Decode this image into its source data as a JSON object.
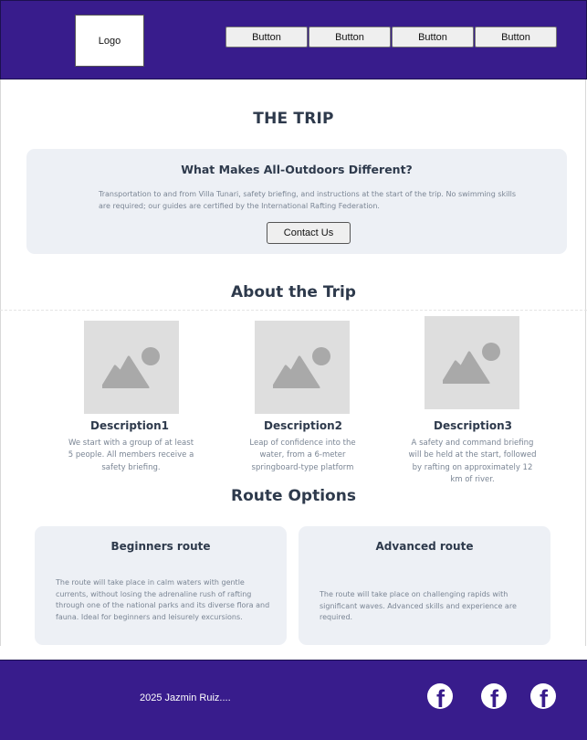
{
  "header": {
    "logo": "Logo",
    "nav": [
      "Button",
      "Button",
      "Button",
      "Button"
    ]
  },
  "trip": {
    "title": "THE TRIP",
    "card_title": "What Makes All-Outdoors Different?",
    "card_text": "Transportation to and from Villa Tunari, safety briefing, and instructions at the start of the trip. No swimming skills are required; our guides are certified by the International Rafting Federation.",
    "contact_label": "Contact Us"
  },
  "about": {
    "title": "About the Trip",
    "items": [
      {
        "title": "Description1",
        "text": "We start with a group of at least 5 people. All members receive a safety briefing."
      },
      {
        "title": "Description2",
        "text": "Leap of confidence into the water, from a 6-meter springboard-type platform"
      },
      {
        "title": "Description3",
        "text": "A safety and command briefing will be held at the start, followed by rafting on approximately 12 km of river."
      }
    ]
  },
  "routes": {
    "title": "Route Options",
    "items": [
      {
        "name": "Beginners route",
        "text": "The route will take place in calm waters with gentle currents, without losing the adrenaline rush of rafting through one of the national parks and its diverse flora and fauna. Ideal for beginners and leisurely excursions."
      },
      {
        "name": "Advanced route",
        "text": "The route will take place on challenging rapids with significant waves. Advanced skills and experience are required."
      }
    ]
  },
  "footer": {
    "copyright": "2025 Jazmin Ruiz....",
    "social_icon": "facebook-icon",
    "social_glyph": "f"
  },
  "colors": {
    "brand": "#381c8c",
    "card_bg": "#edf0f5",
    "heading": "#2e3a4c",
    "body_text": "#7a8594"
  }
}
